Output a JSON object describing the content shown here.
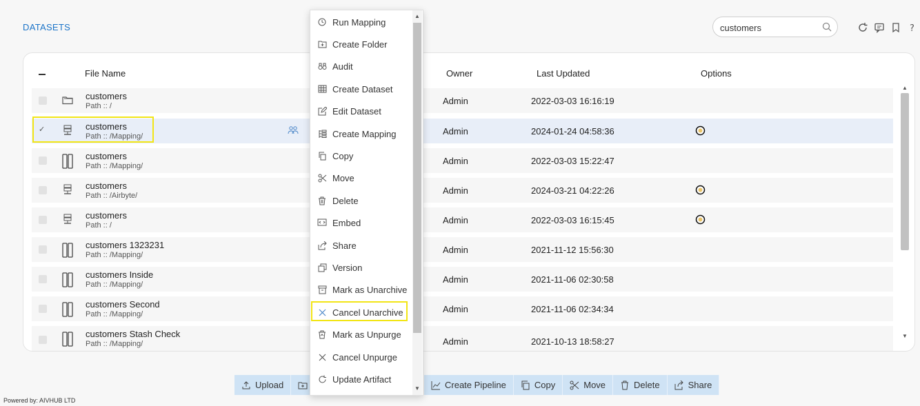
{
  "header": {
    "title": "DATASETS"
  },
  "search": {
    "value": "customers"
  },
  "table": {
    "columns": {
      "file_name": "File Name",
      "owner": "Owner",
      "last_updated": "Last Updated",
      "options": "Options"
    },
    "rows": [
      {
        "name": "customers",
        "path": "Path :: /",
        "owner": "Admin",
        "updated": "2022-03-03 16:16:19",
        "icon": "folder-icon",
        "option": ""
      },
      {
        "name": "customers",
        "path": "Path :: /Mapping/",
        "owner": "Admin",
        "updated": "2024-01-24 04:58:36",
        "icon": "server-icon",
        "option": "clock-icon"
      },
      {
        "name": "customers",
        "path": "Path :: /Mapping/",
        "owner": "Admin",
        "updated": "2022-03-03 15:22:47",
        "icon": "columns-icon",
        "option": ""
      },
      {
        "name": "customers",
        "path": "Path :: /Airbyte/",
        "owner": "Admin",
        "updated": "2024-03-21 04:22:26",
        "icon": "server-icon",
        "option": "clock-icon"
      },
      {
        "name": "customers",
        "path": "Path :: /",
        "owner": "Admin",
        "updated": "2022-03-03 16:15:45",
        "icon": "server-icon",
        "option": "clock-icon"
      },
      {
        "name": "customers 1323231",
        "path": "Path :: /Mapping/",
        "owner": "Admin",
        "updated": "2021-11-12 15:56:30",
        "icon": "columns-icon",
        "option": ""
      },
      {
        "name": "customers Inside",
        "path": "Path :: /Mapping/",
        "owner": "Admin",
        "updated": "2021-11-06 02:30:58",
        "icon": "columns-icon",
        "option": ""
      },
      {
        "name": "customers Second",
        "path": "Path :: /Mapping/",
        "owner": "Admin",
        "updated": "2021-11-06 02:34:34",
        "icon": "columns-icon",
        "option": ""
      },
      {
        "name": "customers Stash Check",
        "path": "Path :: /Mapping/",
        "owner": "Admin",
        "updated": "2021-10-13 18:58:27",
        "icon": "columns-icon",
        "option": ""
      }
    ]
  },
  "context_menu": {
    "items": [
      {
        "label": "Run Mapping",
        "icon": "history-icon"
      },
      {
        "label": "Create Folder",
        "icon": "folder-plus-icon"
      },
      {
        "label": "Audit",
        "icon": "binoculars-icon"
      },
      {
        "label": "Create Dataset",
        "icon": "table-icon"
      },
      {
        "label": "Edit Dataset",
        "icon": "edit-icon"
      },
      {
        "label": "Create Mapping",
        "icon": "mapping-icon"
      },
      {
        "label": "Copy",
        "icon": "copy-icon"
      },
      {
        "label": "Move",
        "icon": "scissors-icon"
      },
      {
        "label": "Delete",
        "icon": "trash-icon"
      },
      {
        "label": "Embed",
        "icon": "embed-icon"
      },
      {
        "label": "Share",
        "icon": "share-icon"
      },
      {
        "label": "Version",
        "icon": "version-icon"
      },
      {
        "label": "Mark as Unarchive",
        "icon": "archive-icon"
      },
      {
        "label": "Cancel Unarchive",
        "icon": "close-icon"
      },
      {
        "label": "Mark as Unpurge",
        "icon": "trash-restore-icon"
      },
      {
        "label": "Cancel Unpurge",
        "icon": "close-icon"
      },
      {
        "label": "Update Artifact",
        "icon": "refresh-icon"
      }
    ]
  },
  "toolbar": {
    "upload": "Upload",
    "create_pipeline": "Create Pipeline",
    "copy": "Copy",
    "move": "Move",
    "delete": "Delete",
    "share": "Share"
  },
  "footer": {
    "powered_by": "Powered by: AIVHUB LTD"
  },
  "colors": {
    "accent": "#1a73c8",
    "highlight": "#f2e515",
    "toolbar_bg": "#cfe3f5",
    "selected_row": "#e8eef8"
  }
}
